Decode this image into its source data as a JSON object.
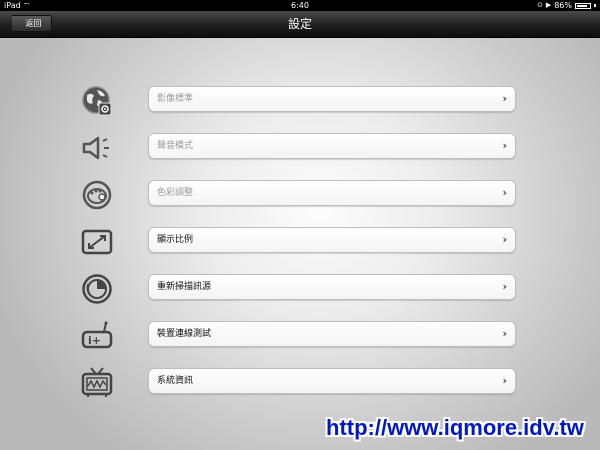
{
  "status_bar": {
    "carrier": "iPad",
    "time": "6:40",
    "battery": "86%",
    "battery_level": 0.86
  },
  "nav": {
    "title": "設定",
    "back_label": "返回"
  },
  "settings": [
    {
      "label": "影像標準",
      "icon": "globe-gear-icon",
      "enabled": false
    },
    {
      "label": "聲音模式",
      "icon": "speaker-icon",
      "enabled": false
    },
    {
      "label": "色彩調整",
      "icon": "palette-icon",
      "enabled": false
    },
    {
      "label": "顯示比例",
      "icon": "aspect-ratio-icon",
      "enabled": true
    },
    {
      "label": "重新掃描訊源",
      "icon": "scan-icon",
      "enabled": true
    },
    {
      "label": "裝置連線測試",
      "icon": "connection-test-icon",
      "enabled": true
    },
    {
      "label": "系統資訊",
      "icon": "tv-icon",
      "enabled": true
    }
  ],
  "watermark": "http://www.iqmore.idv.tw"
}
